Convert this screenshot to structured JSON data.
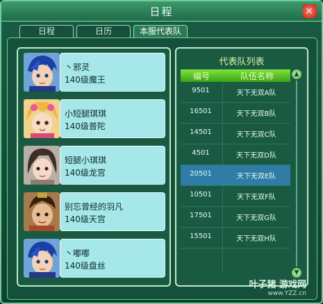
{
  "window": {
    "title": "日程",
    "close_label": "×"
  },
  "tabs": [
    {
      "label": "日程",
      "active": false
    },
    {
      "label": "日历",
      "active": false
    },
    {
      "label": "本服代表队",
      "active": true
    }
  ],
  "players": [
    {
      "name": "丶邪灵",
      "level": "140级魔王",
      "avatar": "blue-hair-warrior-portrait"
    },
    {
      "name": "小短腿琪琪",
      "level": "140级普陀",
      "avatar": "blonde-girl-portrait"
    },
    {
      "name": "短腿小琪琪",
      "level": "140级龙宫",
      "avatar": "dark-hair-girl-portrait"
    },
    {
      "name": "别忘曾经的羽凡",
      "level": "140级天宫",
      "avatar": "warrior-portrait"
    },
    {
      "name": "丶嘟嘟",
      "level": "140级盘丝",
      "avatar": "blue-hair-warrior-portrait"
    }
  ],
  "team_list": {
    "title": "代表队列表",
    "col_id": "编号",
    "col_name": "队伍名称",
    "rows": [
      {
        "id": "9501",
        "name": "天下无双A队"
      },
      {
        "id": "16501",
        "name": "天下无双B队"
      },
      {
        "id": "14501",
        "name": "天下无双C队"
      },
      {
        "id": "4501",
        "name": "天下无双D队"
      },
      {
        "id": "20501",
        "name": "天下无双E队"
      },
      {
        "id": "10501",
        "name": "天下无双F队"
      },
      {
        "id": "17501",
        "name": "天下无双G队"
      },
      {
        "id": "15501",
        "name": "天下无双H队"
      }
    ],
    "selected_row": 4
  },
  "scroll": {
    "up_label": "▲",
    "down_label": "▼"
  },
  "watermark": {
    "brand": "叶子猪 游戏网",
    "url": "www.YZZ.cn"
  }
}
